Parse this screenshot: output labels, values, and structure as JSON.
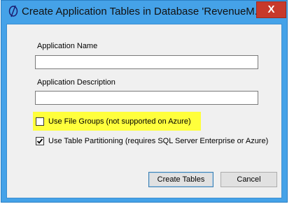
{
  "window": {
    "title": "Create Application Tables in Database 'RevenueM...",
    "close_glyph": "X",
    "icon": "app-logo-icon"
  },
  "form": {
    "app_name": {
      "label": "Application Name",
      "value": ""
    },
    "app_description": {
      "label": "Application Description",
      "value": ""
    },
    "use_file_groups": {
      "label": "Use File Groups (not supported on Azure)",
      "checked": false,
      "highlight_color": "#ffff3c"
    },
    "use_table_partitioning": {
      "label": "Use Table Partitioning (requires SQL Server Enterprise or Azure)",
      "checked": true
    }
  },
  "buttons": {
    "create_tables": "Create Tables",
    "cancel": "Cancel"
  },
  "colors": {
    "titlebar": "#45a2e8",
    "close": "#c7392b",
    "dialog_bg": "#f0f0f0"
  }
}
